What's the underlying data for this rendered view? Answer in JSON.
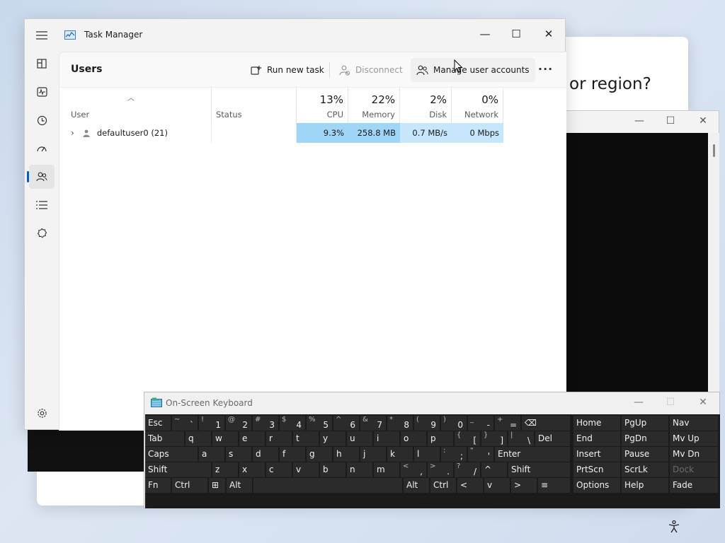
{
  "background": {
    "dialog_title": "or region?"
  },
  "task_manager": {
    "title": "Task Manager",
    "nav": [
      {
        "icon": "hamburger-icon",
        "name": "nav-menu-button"
      },
      {
        "icon": "processes-icon",
        "name": "nav-processes"
      },
      {
        "icon": "performance-icon",
        "name": "nav-performance"
      },
      {
        "icon": "app-history-icon",
        "name": "nav-app-history"
      },
      {
        "icon": "startup-apps-icon",
        "name": "nav-startup-apps"
      },
      {
        "icon": "users-icon",
        "name": "nav-users"
      },
      {
        "icon": "details-icon",
        "name": "nav-details"
      },
      {
        "icon": "services-icon",
        "name": "nav-services"
      }
    ],
    "settings_icon": "gear-icon",
    "page_title": "Users",
    "commands": {
      "run_new_task": "Run new task",
      "disconnect": "Disconnect",
      "manage_user_accounts": "Manage user accounts"
    },
    "columns": {
      "user": "User",
      "status": "Status",
      "cpu": {
        "label": "CPU",
        "pct": "13%"
      },
      "memory": {
        "label": "Memory",
        "pct": "22%"
      },
      "disk": {
        "label": "Disk",
        "pct": "2%"
      },
      "network": {
        "label": "Network",
        "pct": "0%"
      }
    },
    "rows": [
      {
        "user": "defaultuser0 (21)",
        "status": "",
        "cpu": "9.3%",
        "memory": "258.8 MB",
        "disk": "0.7 MB/s",
        "network": "0 Mbps"
      }
    ],
    "colors": {
      "accent": "#005fb8",
      "heat_strong": "#9fd5f7",
      "heat_medium": "#b8e0fb",
      "heat_light": "#d2ecfd"
    }
  },
  "osk": {
    "title": "On-Screen Keyboard",
    "rows": [
      [
        {
          "m": "Esc"
        },
        {
          "up": "~",
          "lo": "`"
        },
        {
          "up": "!",
          "lo": "1"
        },
        {
          "up": "@",
          "lo": "2"
        },
        {
          "up": "#",
          "lo": "3"
        },
        {
          "up": "$",
          "lo": "4"
        },
        {
          "up": "%",
          "lo": "5"
        },
        {
          "up": "^",
          "lo": "6"
        },
        {
          "up": "&",
          "lo": "7"
        },
        {
          "up": "*",
          "lo": "8"
        },
        {
          "up": "(",
          "lo": "9"
        },
        {
          "up": ")",
          "lo": "0"
        },
        {
          "up": "_",
          "lo": "-"
        },
        {
          "up": "+",
          "lo": "="
        },
        {
          "m": "⌫"
        },
        {
          "m": "Home"
        },
        {
          "m": "PgUp"
        },
        {
          "m": "Nav"
        }
      ],
      [
        {
          "m": "Tab"
        },
        {
          "m": "q"
        },
        {
          "m": "w"
        },
        {
          "m": "e"
        },
        {
          "m": "r"
        },
        {
          "m": "t"
        },
        {
          "m": "y"
        },
        {
          "m": "u"
        },
        {
          "m": "i"
        },
        {
          "m": "o"
        },
        {
          "m": "p"
        },
        {
          "up": "{",
          "lo": "["
        },
        {
          "up": "}",
          "lo": "]"
        },
        {
          "up": "|",
          "lo": "\\"
        },
        {
          "m": "Del"
        },
        {
          "m": "End"
        },
        {
          "m": "PgDn"
        },
        {
          "m": "Mv Up"
        }
      ],
      [
        {
          "m": "Caps"
        },
        {
          "m": "a"
        },
        {
          "m": "s"
        },
        {
          "m": "d"
        },
        {
          "m": "f"
        },
        {
          "m": "g"
        },
        {
          "m": "h"
        },
        {
          "m": "j"
        },
        {
          "m": "k"
        },
        {
          "m": "l"
        },
        {
          "up": ":",
          "lo": ";"
        },
        {
          "up": "\"",
          "lo": "'"
        },
        {
          "m": "Enter"
        },
        {
          "m": "Insert"
        },
        {
          "m": "Pause"
        },
        {
          "m": "Mv Dn"
        }
      ],
      [
        {
          "m": "Shift"
        },
        {
          "m": "z"
        },
        {
          "m": "x"
        },
        {
          "m": "c"
        },
        {
          "m": "v"
        },
        {
          "m": "b"
        },
        {
          "m": "n"
        },
        {
          "m": "m"
        },
        {
          "up": "<",
          "lo": ","
        },
        {
          "up": ">",
          "lo": "."
        },
        {
          "up": "?",
          "lo": "/"
        },
        {
          "m": "^"
        },
        {
          "m": "Shift"
        },
        {
          "m": "PrtScn"
        },
        {
          "m": "ScrLk"
        },
        {
          "m": "Dock"
        }
      ],
      [
        {
          "m": "Fn"
        },
        {
          "m": "Ctrl"
        },
        {
          "m": "⊞"
        },
        {
          "m": "Alt"
        },
        {
          "m": ""
        },
        {
          "m": "Alt"
        },
        {
          "m": "Ctrl"
        },
        {
          "m": "<"
        },
        {
          "m": "v"
        },
        {
          "m": ">"
        },
        {
          "m": "≡"
        },
        {
          "m": "Options"
        },
        {
          "m": "Help"
        },
        {
          "m": "Fade"
        }
      ]
    ]
  }
}
